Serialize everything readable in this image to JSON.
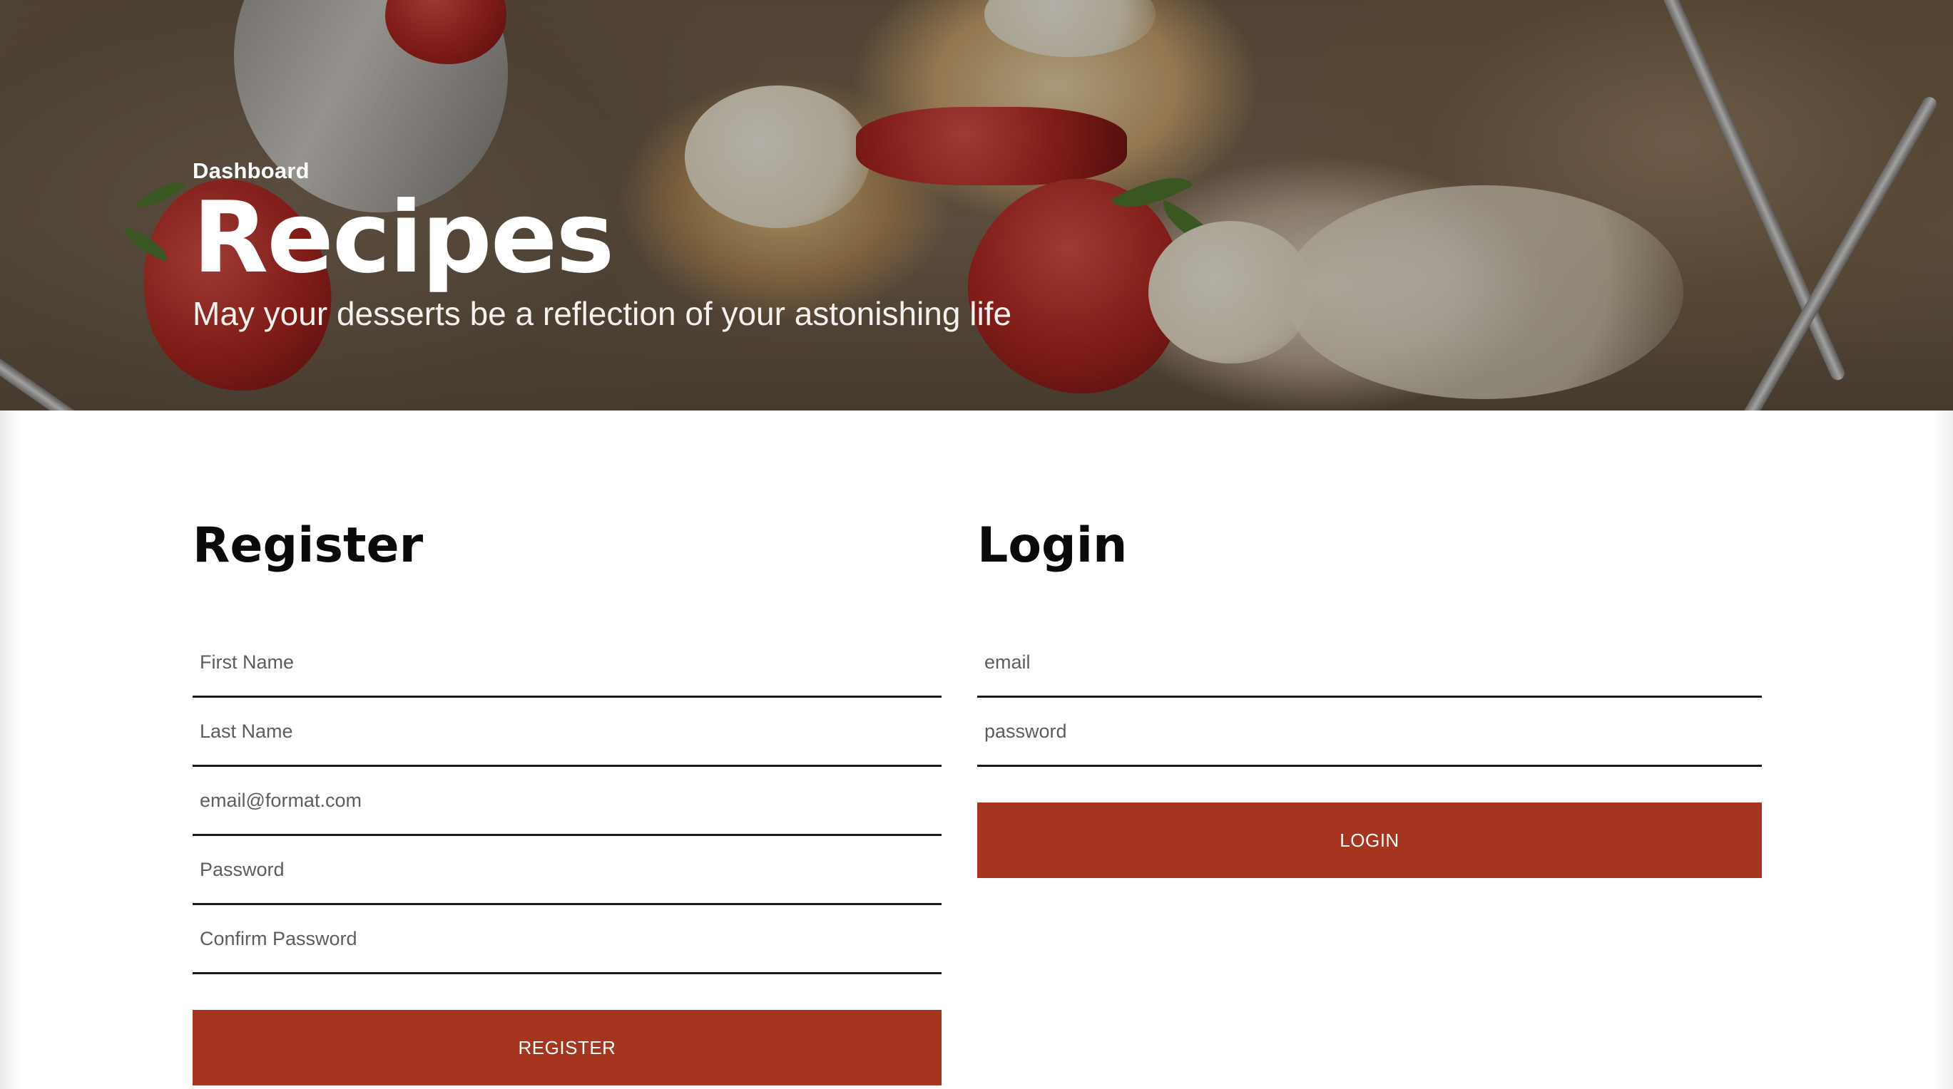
{
  "hero": {
    "breadcrumb": "Dashboard",
    "title": "Recipes",
    "tagline": "May your desserts be a reflection of your astonishing life"
  },
  "register": {
    "heading": "Register",
    "fields": {
      "first_name": "First Name",
      "last_name": "Last Name",
      "email": "email@format.com",
      "password": "Password",
      "confirm_password": "Confirm Password"
    },
    "button_label": "REGISTER"
  },
  "login": {
    "heading": "Login",
    "fields": {
      "email": "email",
      "password": "password"
    },
    "button_label": "LOGIN"
  },
  "colors": {
    "accent": "#a5351e",
    "heading": "#0a0a0a",
    "field_underline": "#1a1a1a"
  }
}
